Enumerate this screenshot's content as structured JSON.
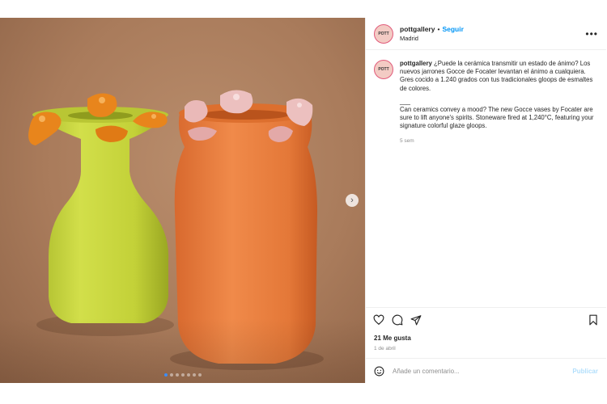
{
  "post": {
    "image_alt_dots": 7,
    "active_slide": 1
  },
  "header": {
    "avatar_text": "POTT",
    "username": "pottgallery",
    "separator": "•",
    "follow_label": "Seguir",
    "location": "Madrid",
    "more_icon": "more-horizontal-icon"
  },
  "caption": {
    "avatar_text": "POTT",
    "username": "pottgallery",
    "text_es": "¿Puede la cerámica transmitir un estado de ánimo? Los nuevos jarrones Gocce de Focater levantan el ánimo a cualquiera. Gres cocido a 1.240 grados con tus tradicionales gloops de esmaltes de colores.",
    "divider": "___",
    "text_en": "Can ceramics convey a mood? The new Gocce vases by Focater are sure to lift anyone's spirits. Stoneware fired at 1,240°C, featuring your signature colorful glaze gloops.",
    "time_ago": "5 sem"
  },
  "actions": {
    "like_icon": "heart-icon",
    "comment_icon": "comment-icon",
    "share_icon": "send-icon",
    "save_icon": "bookmark-icon"
  },
  "likes": "21 Me gusta",
  "date": "1 de abril",
  "comment_box": {
    "emoji_icon": "emoji-icon",
    "placeholder": "Añade un comentario...",
    "publish_label": "Publicar"
  },
  "colors": {
    "accent": "#0095f6",
    "publish_disabled": "#b2dffc",
    "background_clay": "#a97b5b",
    "vase_green": "#c5d43c",
    "vase_orange": "#ec7c3c",
    "gloop_orange": "#e8851c",
    "gloop_pink": "#eab9b8"
  }
}
